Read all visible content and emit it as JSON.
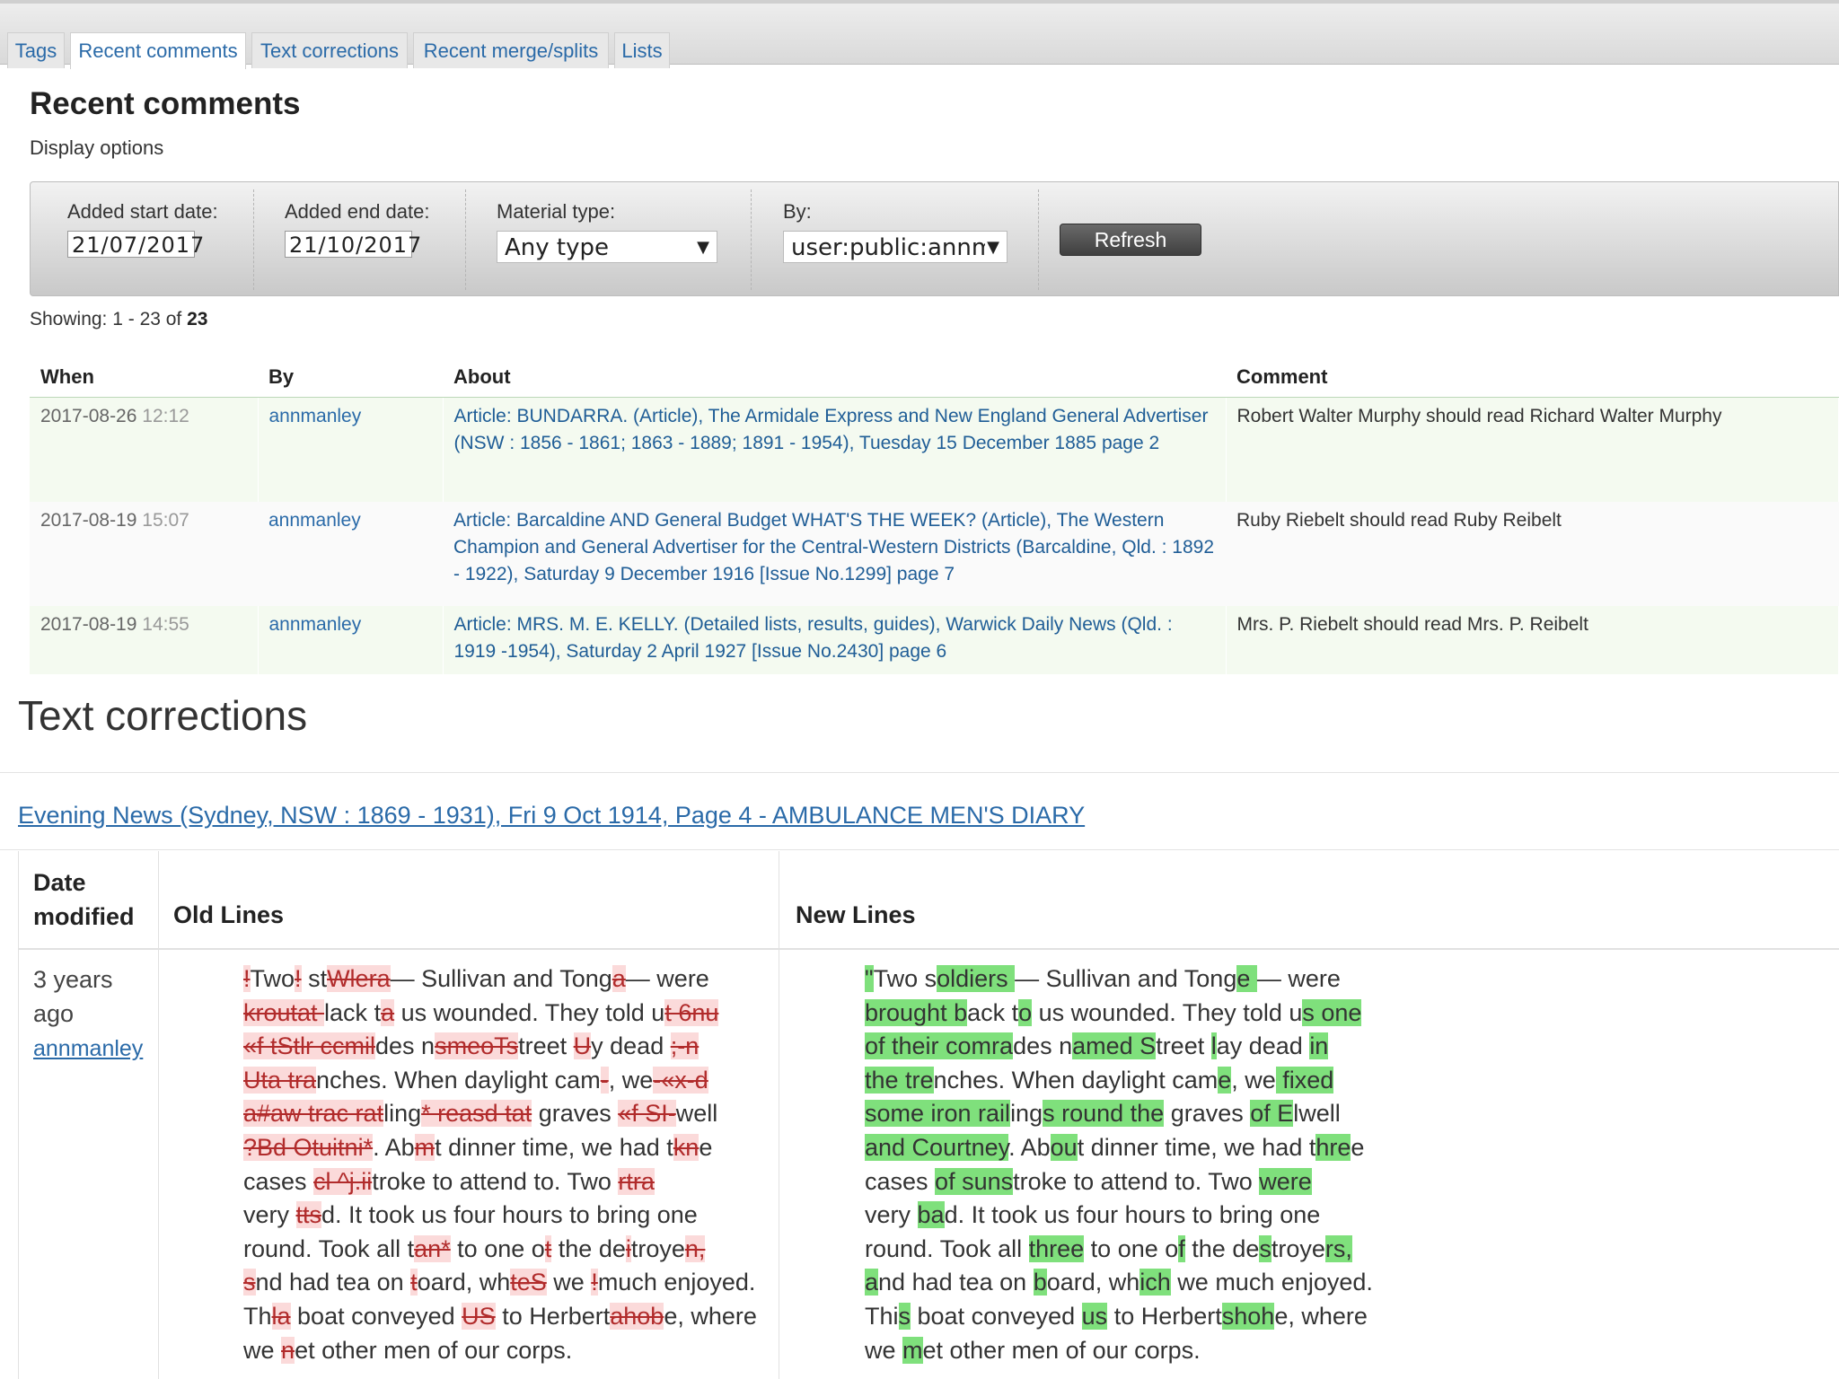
{
  "tabs": [
    "Tags",
    "Recent comments",
    "Text corrections",
    "Recent merge/splits",
    "Lists"
  ],
  "page_title": "Recent comments",
  "display_options": "Display options",
  "options": {
    "start_label": "Added start date:",
    "start_value": "21/07/2017",
    "end_label": "Added end date:",
    "end_value": "21/10/2017",
    "material_label": "Material type:",
    "material_value": "Any type",
    "by_label": "By:",
    "by_value": "user:public:annm",
    "refresh_label": "Refresh"
  },
  "showing": {
    "prefix": "Showing: 1 - 23 of ",
    "total": "23"
  },
  "comments": {
    "headers": [
      "When",
      "By",
      "About",
      "Comment"
    ],
    "rows": [
      {
        "date": "2017-08-26",
        "time": "12:12",
        "by": "annmanley",
        "about": "Article: BUNDARRA. (Article), The Armidale Express and New England General Advertiser (NSW : 1856 - 1861; 1863 - 1889; 1891 - 1954), Tuesday 15 December 1885 page 2",
        "comment": "Robert Walter Murphy should read Richard Walter Murphy"
      },
      {
        "date": "2017-08-19",
        "time": "15:07",
        "by": "annmanley",
        "about": "Article: Barcaldine AND General Budget WHAT'S THE WEEK? (Article), The Western Champion and General Advertiser for the Central-Western Districts (Barcaldine, Qld. : 1892 - 1922), Saturday 9 December 1916 [Issue No.1299] page 7",
        "comment": "Ruby Riebelt should read Ruby Reibelt"
      },
      {
        "date": "2017-08-19",
        "time": "14:55",
        "by": "annmanley",
        "about": "Article: MRS. M. E. KELLY. (Detailed lists, results, guides), Warwick Daily News (Qld. : 1919 -1954), Saturday 2 April 1927 [Issue No.2430] page 6",
        "comment": "Mrs. P. Riebelt should read Mrs. P. Reibelt"
      }
    ]
  },
  "text_corrections": {
    "title": "Text corrections",
    "article_link": "Evening News (Sydney, NSW : 1869 - 1931), Fri 9 Oct 1914, Page 4 - AMBULANCE MEN'S DIARY",
    "header_date_1": "Date",
    "header_date_2": "modified",
    "header_old": "Old Lines",
    "header_new": "New Lines",
    "date_1": "3 years",
    "date_2": "ago",
    "user": "annmanley"
  },
  "old_lines": [
    [
      [
        "d",
        "!"
      ],
      [
        "n",
        "Two"
      ],
      [
        "d",
        "!"
      ],
      [
        "n",
        " st"
      ],
      [
        "d",
        "Wlera"
      ],
      [
        "n",
        "— Sullivan and Tong"
      ],
      [
        "d",
        "a"
      ],
      [
        "n",
        "— were"
      ]
    ],
    [
      [
        "d",
        "kroutat "
      ],
      [
        "n",
        "lack t"
      ],
      [
        "d",
        "a"
      ],
      [
        "n",
        " us wounded. They told u"
      ],
      [
        "d",
        "t 6nu"
      ]
    ],
    [
      [
        "d",
        "«f tStlr ccmil"
      ],
      [
        "n",
        "des n"
      ],
      [
        "d",
        "smeoTs"
      ],
      [
        "n",
        "treet "
      ],
      [
        "d",
        "U"
      ],
      [
        "n",
        "y dead "
      ],
      [
        "d",
        ";-n"
      ]
    ],
    [
      [
        "d",
        "Uta tra"
      ],
      [
        "n",
        "nches. When daylight cam"
      ],
      [
        "d",
        "-"
      ],
      [
        "n",
        ", we"
      ],
      [
        "d",
        "-«x-d"
      ]
    ],
    [
      [
        "d",
        "a#aw trac rat"
      ],
      [
        "n",
        "ling"
      ],
      [
        "d",
        "* reasd tat"
      ],
      [
        "n",
        " graves "
      ],
      [
        "d",
        "«f SI-"
      ],
      [
        "n",
        "well"
      ]
    ],
    [
      [
        "d",
        "?Bd Otuitni*"
      ],
      [
        "n",
        ". Ab"
      ],
      [
        "d",
        "m"
      ],
      [
        "n",
        "t dinner time, we had t"
      ],
      [
        "d",
        "kn"
      ],
      [
        "n",
        "e"
      ]
    ],
    [
      [
        "n",
        "cases "
      ],
      [
        "d",
        "cl ^j.ii"
      ],
      [
        "n",
        "troke to attend to. Two "
      ],
      [
        "d",
        "rtra"
      ]
    ],
    [
      [
        "n",
        "very "
      ],
      [
        "d",
        "tts"
      ],
      [
        "n",
        "d. It took us four hours to bring one"
      ]
    ],
    [
      [
        "n",
        "round. Took all t"
      ],
      [
        "d",
        "an*"
      ],
      [
        "n",
        " to one o"
      ],
      [
        "d",
        "t"
      ],
      [
        "n",
        " the de"
      ],
      [
        "d",
        "i"
      ],
      [
        "n",
        "troye"
      ],
      [
        "d",
        "n,"
      ]
    ],
    [
      [
        "d",
        "s"
      ],
      [
        "n",
        "nd had tea on "
      ],
      [
        "d",
        "t"
      ],
      [
        "n",
        "oard, wh"
      ],
      [
        "d",
        "teS"
      ],
      [
        "n",
        " we "
      ],
      [
        "d",
        "!"
      ],
      [
        "n",
        "much enjoyed."
      ]
    ],
    [
      [
        "n",
        "Th"
      ],
      [
        "d",
        "la"
      ],
      [
        "n",
        " boat conveyed "
      ],
      [
        "d",
        "US"
      ],
      [
        "n",
        " to Herbert"
      ],
      [
        "d",
        "ahob"
      ],
      [
        "n",
        "e, where"
      ]
    ],
    [
      [
        "n",
        "we "
      ],
      [
        "d",
        "n"
      ],
      [
        "n",
        "et other men of our corps."
      ]
    ]
  ],
  "new_lines": [
    [
      [
        "i",
        "\""
      ],
      [
        "n",
        "Two s"
      ],
      [
        "i",
        "oldiers "
      ],
      [
        "n",
        "— Sullivan and Tong"
      ],
      [
        "i",
        "e "
      ],
      [
        "n",
        "— were"
      ]
    ],
    [
      [
        "i",
        "brought b"
      ],
      [
        "n",
        "ack t"
      ],
      [
        "i",
        "o"
      ],
      [
        "n",
        " us wounded. They told u"
      ],
      [
        "i",
        "s one"
      ]
    ],
    [
      [
        "i",
        "of their comra"
      ],
      [
        "n",
        "des n"
      ],
      [
        "i",
        "amed S"
      ],
      [
        "n",
        "treet "
      ],
      [
        "i",
        "l"
      ],
      [
        "n",
        "ay dead "
      ],
      [
        "i",
        "in"
      ]
    ],
    [
      [
        "i",
        "the tre"
      ],
      [
        "n",
        "nches. When daylight cam"
      ],
      [
        "i",
        "e"
      ],
      [
        "n",
        ", we"
      ],
      [
        "i",
        " fixed"
      ]
    ],
    [
      [
        "i",
        "some iron rail"
      ],
      [
        "n",
        "ing"
      ],
      [
        "i",
        "s round the"
      ],
      [
        "n",
        " graves "
      ],
      [
        "i",
        "of E"
      ],
      [
        "n",
        "lwell"
      ]
    ],
    [
      [
        "i",
        "and Courtney"
      ],
      [
        "n",
        ". Ab"
      ],
      [
        "i",
        "ou"
      ],
      [
        "n",
        "t dinner time, we had t"
      ],
      [
        "i",
        "hre"
      ],
      [
        "n",
        "e"
      ]
    ],
    [
      [
        "n",
        "cases "
      ],
      [
        "i",
        "of suns"
      ],
      [
        "n",
        "troke to attend to. Two "
      ],
      [
        "i",
        "were"
      ]
    ],
    [
      [
        "n",
        "very "
      ],
      [
        "i",
        "ba"
      ],
      [
        "n",
        "d. It took us four hours to bring one"
      ]
    ],
    [
      [
        "n",
        "round. Took all "
      ],
      [
        "i",
        "three"
      ],
      [
        "n",
        " to one o"
      ],
      [
        "i",
        "f"
      ],
      [
        "n",
        " the de"
      ],
      [
        "i",
        "s"
      ],
      [
        "n",
        "troye"
      ],
      [
        "i",
        "rs,"
      ]
    ],
    [
      [
        "i",
        "a"
      ],
      [
        "n",
        "nd had tea on "
      ],
      [
        "i",
        "b"
      ],
      [
        "n",
        "oard, wh"
      ],
      [
        "i",
        "ich"
      ],
      [
        "n",
        " we much enjoyed."
      ]
    ],
    [
      [
        "n",
        "Thi"
      ],
      [
        "i",
        "s"
      ],
      [
        "n",
        " boat conveyed "
      ],
      [
        "i",
        "us"
      ],
      [
        "n",
        " to Herbert"
      ],
      [
        "i",
        "shoh"
      ],
      [
        "n",
        "e, where"
      ]
    ],
    [
      [
        "n",
        "we "
      ],
      [
        "i",
        "m"
      ],
      [
        "n",
        "et other men of our corps."
      ]
    ]
  ]
}
